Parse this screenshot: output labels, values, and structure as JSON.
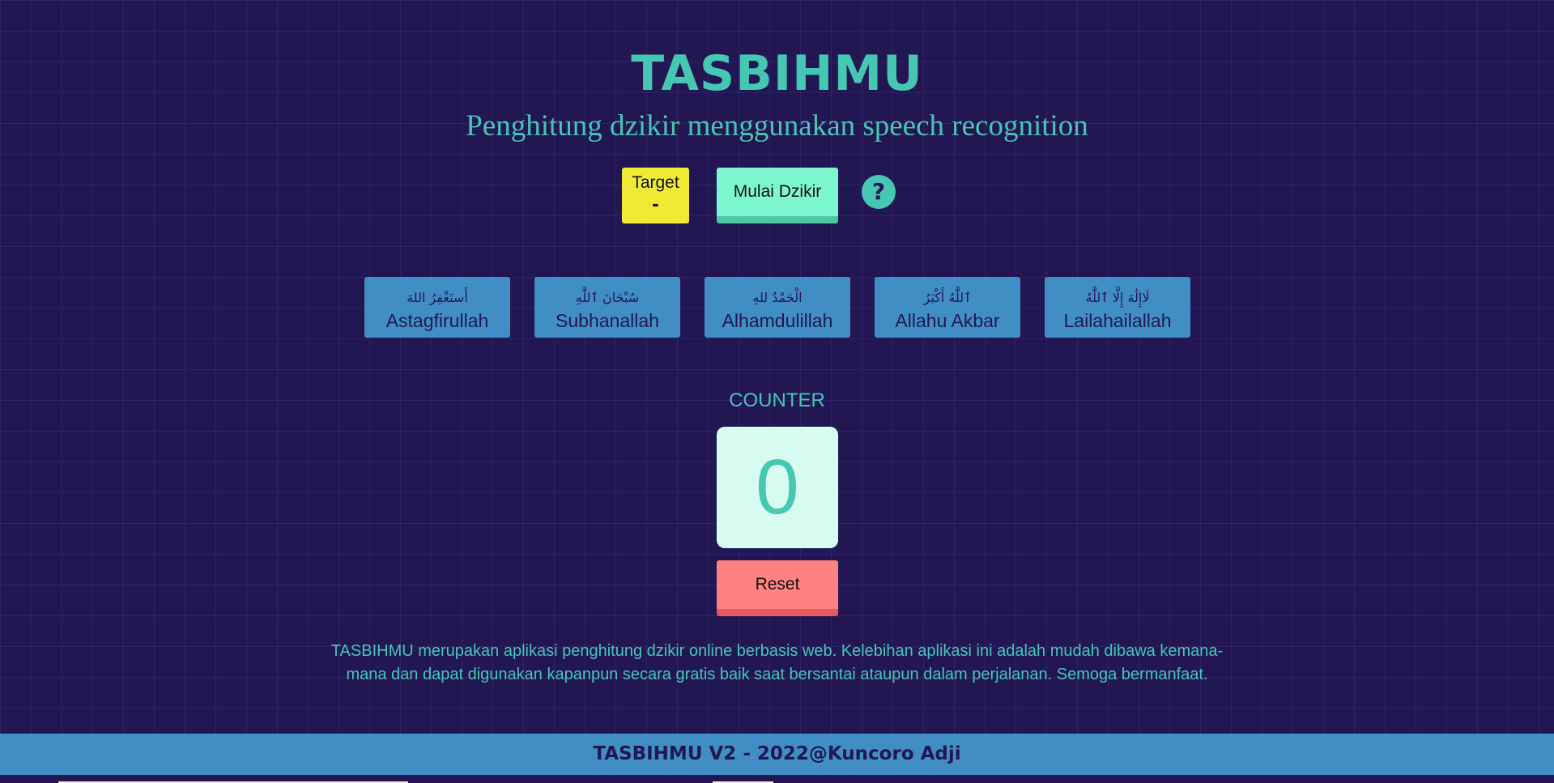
{
  "header": {
    "title": "TASBIHMU",
    "subtitle": "Penghitung dzikir menggunakan speech recognition"
  },
  "controls": {
    "target_label": "Target",
    "target_value": "-",
    "start_label": "Mulai Dzikir",
    "help_label": "?"
  },
  "dzikir": [
    {
      "arabic": "أَستَغْفِرُ اللهَ",
      "latin": "Astagfirullah"
    },
    {
      "arabic": "سُبْحَانَ ٱللَّٰهِ",
      "latin": "Subhanallah"
    },
    {
      "arabic": "الْحَمْدُ للهِ",
      "latin": "Alhamdulillah"
    },
    {
      "arabic": "ٱللَّٰهُ أَكْبَرُ",
      "latin": "Allahu Akbar"
    },
    {
      "arabic": "لَاإِلَٰهَ إِلَّا ٱللَّٰهُ",
      "latin": "Lailahailallah"
    }
  ],
  "counter": {
    "label": "COUNTER",
    "value": "0",
    "reset_label": "Reset"
  },
  "description": "TASBIHMU merupakan aplikasi penghitung dzikir online berbasis web. Kelebihan aplikasi ini adalah mudah dibawa kemana-mana dan dapat digunakan kapanpun secara gratis baik saat bersantai ataupun dalam perjalanan. Semoga bermanfaat.",
  "footer": {
    "text": "TASBIHMU V2 - 2022@Kuncoro Adji"
  },
  "colors": {
    "background": "#221753",
    "accent": "#46c7b2",
    "target_yellow": "#efeb35",
    "start_green": "#7cf7cf",
    "dzikir_blue": "#418ec7",
    "reset_red": "#ff8282",
    "counter_bg": "#d6fbf0"
  }
}
